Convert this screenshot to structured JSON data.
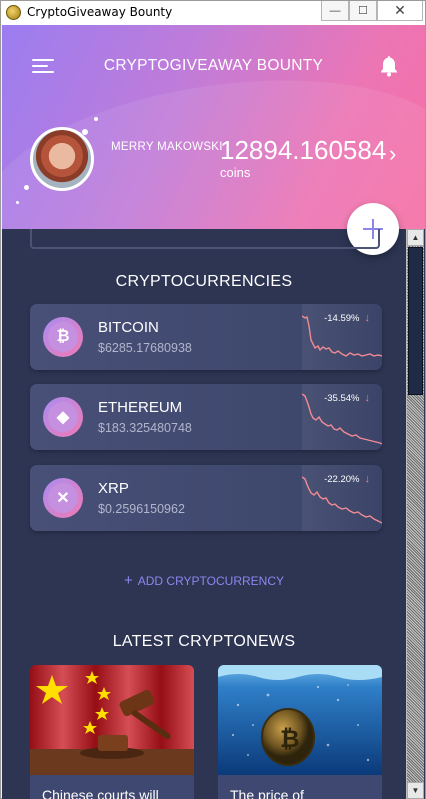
{
  "window": {
    "title": "CryptoGiveaway Bounty",
    "minimize_label": "—",
    "restore_label": "☐",
    "close_label": "✕"
  },
  "header": {
    "title": "CRYPTOGIVEAWAY BOUNTY",
    "username": "MERRY MAKOWSKI",
    "balance": "12894.160584",
    "balance_unit": "coins",
    "chevron": "›"
  },
  "fab": {
    "label": "+"
  },
  "cryptos": {
    "section_title": "CRYPTOCURRENCIES",
    "items": [
      {
        "name": "BITCOIN",
        "price": "$6285.17680938",
        "change": "-14.59%",
        "symbol": "₿",
        "icon": "bitcoin-icon"
      },
      {
        "name": "ETHEREUM",
        "price": "$183.325480748",
        "change": "-35.54%",
        "symbol": "◆",
        "icon": "ethereum-icon"
      },
      {
        "name": "XRP",
        "price": "$0.2596150962",
        "change": "-22.20%",
        "symbol": "✕",
        "icon": "xrp-icon"
      }
    ],
    "add_label": "ADD CRYPTOCURRENCY",
    "add_icon": "+"
  },
  "news": {
    "section_title": "LATEST CRYPTONEWS",
    "items": [
      {
        "title": "Chinese courts will consider cases with",
        "image": "china-flag-gavel-image"
      },
      {
        "title": "The price of cryptocurrencies",
        "image": "bitcoin-underwater-image"
      }
    ]
  },
  "colors": {
    "header_start": "#9b7df0",
    "header_end": "#f66fa5",
    "background": "#2d3553",
    "accent_link": "#8d86ee",
    "negative": "#f07a9c"
  }
}
